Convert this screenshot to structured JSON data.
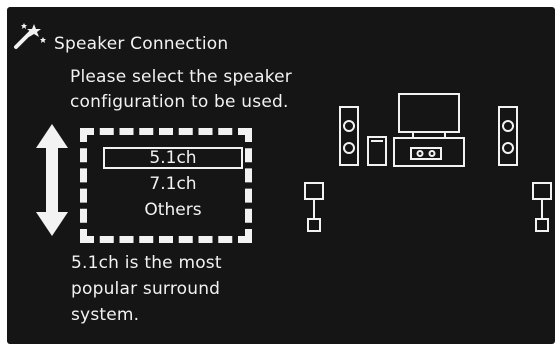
{
  "dialog": {
    "title": "Speaker Connection",
    "title_icon": "wizard-wand-icon",
    "instruction": "Please select the speaker configuration to be used.",
    "options": [
      {
        "label": "5.1ch",
        "selected": true
      },
      {
        "label": "7.1ch",
        "selected": false
      },
      {
        "label": "Others",
        "selected": false
      }
    ],
    "description": "5.1ch is the most popular surround system.",
    "scroll_icon": "up-down-arrow-icon",
    "speaker_layout_icon": "speaker-layout-icon"
  },
  "colors": {
    "background": "#151515",
    "foreground": "#f2f2f2"
  }
}
